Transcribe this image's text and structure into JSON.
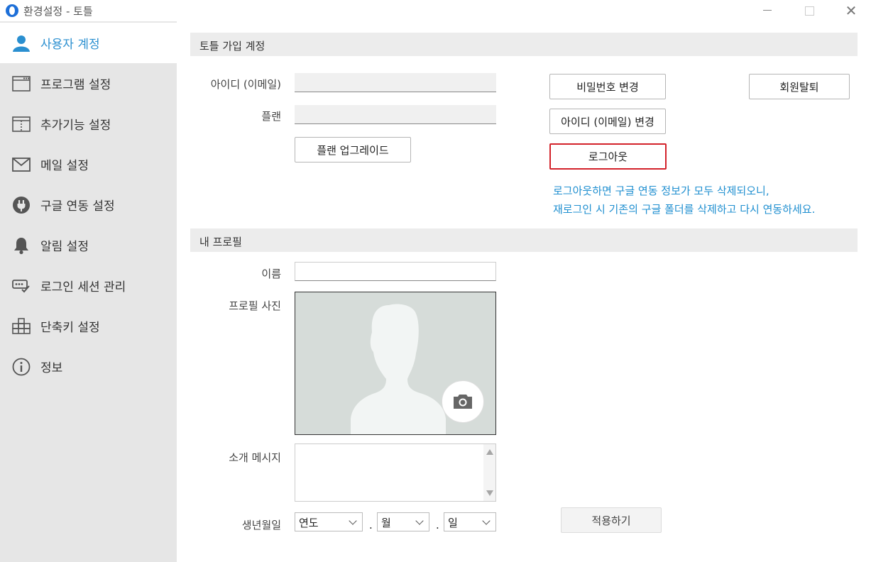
{
  "window": {
    "title": "환경설정 - 토틀",
    "close_glyph": "✕"
  },
  "sidebar": {
    "items": [
      {
        "label": "사용자 계정",
        "icon": "user-icon",
        "active": true
      },
      {
        "label": "프로그램 설정",
        "icon": "window-icon"
      },
      {
        "label": "추가기능 설정",
        "icon": "panel-icon"
      },
      {
        "label": "메일 설정",
        "icon": "mail-icon"
      },
      {
        "label": "구글 연동 설정",
        "icon": "plug-icon"
      },
      {
        "label": "알림 설정",
        "icon": "bell-icon"
      },
      {
        "label": "로그인 세션 관리",
        "icon": "session-icon"
      },
      {
        "label": "단축키 설정",
        "icon": "keyboard-icon"
      },
      {
        "label": "정보",
        "icon": "info-icon"
      }
    ]
  },
  "account": {
    "section_title": "토틀 가입 계정",
    "id_label": "아이디 (이메일)",
    "id_value": "",
    "plan_label": "플랜",
    "plan_value": "",
    "upgrade_button": "플랜 업그레이드",
    "change_password_button": "비밀번호 변경",
    "change_id_button": "아이디 (이메일) 변경",
    "logout_button": "로그아웃",
    "withdraw_button": "회원탈퇴",
    "notice_line1": "로그아웃하면 구글 연동 정보가 모두 삭제되오니,",
    "notice_line2": "재로그인 시 기존의 구글 폴더를 삭제하고 다시 연동하세요.",
    "accent_color": "#1f8fd0",
    "danger_color": "#d3222a"
  },
  "profile": {
    "section_title": "내 프로필",
    "name_label": "이름",
    "name_value": "",
    "photo_label": "프로필 사진",
    "intro_label": "소개 메시지",
    "birthday_label": "생년월일",
    "year_value": "연도",
    "month_value": "월",
    "day_value": "일",
    "separator": ".",
    "apply_button": "적용하기"
  }
}
